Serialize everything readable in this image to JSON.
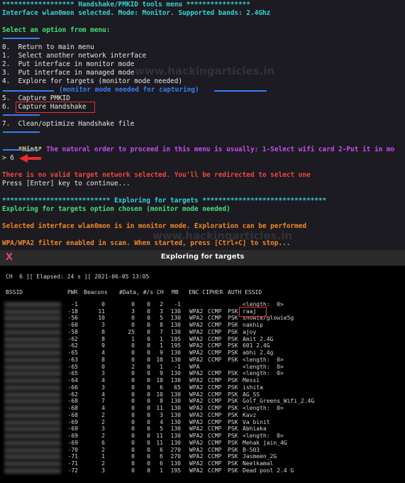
{
  "terminal": {
    "header": "****************** Handshake/PMKID tools menu ****************",
    "interface_line": "Interface wlan0mon selected. Mode: Monitor. Supported bands: 2.4Ghz",
    "select_prompt": "Select an option from menu:",
    "menu_items": [
      "0.  Return to main menu",
      "1.  Select another network interface",
      "2.  Put interface in monitor mode",
      "3.  Put interface in managed mode",
      "4.  Explore for targets (monitor mode needed)"
    ],
    "capture_divider": "(monitor mode needed for capturing)",
    "capture_items": [
      "5.  Capture PMKID",
      "6.  Capture Handshake"
    ],
    "clean_item": "7.  Clean/optimize Handshake file",
    "hint_label": "*Hint*",
    "hint_text": " The natural order to proceed in this menu is usually: 1-Select wifi card 2-Put it in mo",
    "input_prompt": "> 6",
    "error_line": "There is no valid target network selected. You'll be redirected to select one",
    "press_enter": "Press [Enter] key to continue...",
    "explore_header": "*************************** Exploring for targets *******************************",
    "explore_chosen": "Exploring for targets option chosen (monitor mode needed)",
    "selected_iface": "Selected interface wlan0mon is in monitor mode. Exploration can be performed",
    "filter_line": "WPA/WPA2 filter enabled in scan. When started, press [Ctrl+C] to stop...",
    "watermark": "www.hackingarticles.in"
  },
  "window": {
    "title": "Exploring for targets",
    "logo": "X",
    "status": "CH  6 ][ Elapsed: 24 s ][ 2021-06-05 13:05",
    "columns": [
      "BSSID",
      "PWR",
      "Beacons",
      "#Data, #/s",
      "CH",
      "MB",
      "ENC CIPHER",
      "AUTH ESSID"
    ],
    "rows": [
      {
        "pwr": "-1",
        "beacons": "0",
        "data": "0",
        "s": "0",
        "ch": "2",
        "mb": "-1",
        "enc": "",
        "cipher": "",
        "auth": "",
        "essid": "<length:  0>"
      },
      {
        "pwr": "-18",
        "beacons": "11",
        "data": "3",
        "s": "0",
        "ch": "3",
        "mb": "130",
        "enc": "WPA2",
        "cipher": "CCMP",
        "auth": "PSK",
        "essid": "raaj"
      },
      {
        "pwr": "-56",
        "beacons": "10",
        "data": "0",
        "s": "0",
        "ch": "5",
        "mb": "130",
        "enc": "WPA2",
        "cipher": "CCMP",
        "auth": "PSK",
        "essid": "snowie/glowie5g"
      },
      {
        "pwr": "-60",
        "beacons": "3",
        "data": "0",
        "s": "0",
        "ch": "8",
        "mb": "130",
        "enc": "WPA2",
        "cipher": "CCMP",
        "auth": "PSK",
        "essid": "nakhip"
      },
      {
        "pwr": "-58",
        "beacons": "8",
        "data": "25",
        "s": "0",
        "ch": "7",
        "mb": "130",
        "enc": "WPA2",
        "cipher": "CCMP",
        "auth": "PSK",
        "essid": "ajoy"
      },
      {
        "pwr": "-62",
        "beacons": "8",
        "data": "1",
        "s": "0",
        "ch": "1",
        "mb": "195",
        "enc": "WPA2",
        "cipher": "CCMP",
        "auth": "PSK",
        "essid": "Amit 2.4G"
      },
      {
        "pwr": "-62",
        "beacons": "9",
        "data": "0",
        "s": "0",
        "ch": "1",
        "mb": "195",
        "enc": "WPA2",
        "cipher": "CCMP",
        "auth": "PSK",
        "essid": "601 2.4G"
      },
      {
        "pwr": "-65",
        "beacons": "4",
        "data": "0",
        "s": "0",
        "ch": "9",
        "mb": "130",
        "enc": "WPA2",
        "cipher": "CCMP",
        "auth": "PSK",
        "essid": "abhi 2.4g"
      },
      {
        "pwr": "-63",
        "beacons": "8",
        "data": "0",
        "s": "0",
        "ch": "10",
        "mb": "130",
        "enc": "WPA2",
        "cipher": "CCMP",
        "auth": "PSK",
        "essid": "<length:  0>"
      },
      {
        "pwr": "-65",
        "beacons": "0",
        "data": "2",
        "s": "0",
        "ch": "1",
        "mb": "-1",
        "enc": "WPA",
        "cipher": "",
        "auth": "",
        "essid": "<length:  0>"
      },
      {
        "pwr": "-65",
        "beacons": "3",
        "data": "0",
        "s": "0",
        "ch": "9",
        "mb": "130",
        "enc": "WPA2",
        "cipher": "CCMP",
        "auth": "PSK",
        "essid": "<length:  0>"
      },
      {
        "pwr": "-64",
        "beacons": "4",
        "data": "0",
        "s": "0",
        "ch": "10",
        "mb": "130",
        "enc": "WPA2",
        "cipher": "CCMP",
        "auth": "PSK",
        "essid": "Messi"
      },
      {
        "pwr": "-66",
        "beacons": "3",
        "data": "0",
        "s": "0",
        "ch": "6",
        "mb": "65",
        "enc": "WPA2",
        "cipher": "CCMP",
        "auth": "PSK",
        "essid": "ishita"
      },
      {
        "pwr": "-62",
        "beacons": "4",
        "data": "0",
        "s": "0",
        "ch": "10",
        "mb": "130",
        "enc": "WPA2",
        "cipher": "CCMP",
        "auth": "PSK",
        "essid": "AG_SS"
      },
      {
        "pwr": "-68",
        "beacons": "7",
        "data": "0",
        "s": "0",
        "ch": "8",
        "mb": "130",
        "enc": "WPA2",
        "cipher": "CCMP",
        "auth": "PSK",
        "essid": "Golf_Greens_Wifi_2.4G"
      },
      {
        "pwr": "-68",
        "beacons": "4",
        "data": "0",
        "s": "0",
        "ch": "11",
        "mb": "130",
        "enc": "WPA2",
        "cipher": "CCMP",
        "auth": "PSK",
        "essid": "<length:  0>"
      },
      {
        "pwr": "-68",
        "beacons": "2",
        "data": "0",
        "s": "0",
        "ch": "3",
        "mb": "130",
        "enc": "WPA2",
        "cipher": "CCMP",
        "auth": "PSK",
        "essid": "Kavz"
      },
      {
        "pwr": "-69",
        "beacons": "2",
        "data": "0",
        "s": "0",
        "ch": "4",
        "mb": "130",
        "enc": "WPA2",
        "cipher": "CCMP",
        "auth": "PSK",
        "essid": "Va binit"
      },
      {
        "pwr": "-69",
        "beacons": "3",
        "data": "0",
        "s": "0",
        "ch": "5",
        "mb": "130",
        "enc": "WPA2",
        "cipher": "CCMP",
        "auth": "PSK",
        "essid": "Abhiaka"
      },
      {
        "pwr": "-69",
        "beacons": "2",
        "data": "0",
        "s": "0",
        "ch": "11",
        "mb": "130",
        "enc": "WPA2",
        "cipher": "CCMP",
        "auth": "PSK",
        "essid": "<length:  0>"
      },
      {
        "pwr": "-69",
        "beacons": "6",
        "data": "0",
        "s": "0",
        "ch": "11",
        "mb": "130",
        "enc": "WPA2",
        "cipher": "CCMP",
        "auth": "PSK",
        "essid": "Mehak jain_4G"
      },
      {
        "pwr": "-70",
        "beacons": "2",
        "data": "0",
        "s": "0",
        "ch": "6",
        "mb": "270",
        "enc": "WPA2",
        "cipher": "CCMP",
        "auth": "PSK",
        "essid": "B-503"
      },
      {
        "pwr": "-71",
        "beacons": "1",
        "data": "0",
        "s": "0",
        "ch": "6",
        "mb": "270",
        "enc": "WPA2",
        "cipher": "CCMP",
        "auth": "PSK",
        "essid": "Jasmeen_2G"
      },
      {
        "pwr": "-71",
        "beacons": "2",
        "data": "0",
        "s": "0",
        "ch": "6",
        "mb": "130",
        "enc": "WPA2",
        "cipher": "CCMP",
        "auth": "PSK",
        "essid": "Neelkamal"
      },
      {
        "pwr": "-72",
        "beacons": "3",
        "data": "0",
        "s": "0",
        "ch": "1",
        "mb": "195",
        "enc": "WPA2",
        "cipher": "CCMP",
        "auth": "PSK",
        "essid": "Dead pool 2.4 G"
      }
    ]
  },
  "colors": {
    "cyan": "#2fd2d6",
    "green": "#40e07a",
    "red": "#f0473a",
    "orange": "#f08a1a",
    "yellow": "#f0d23a",
    "magenta": "#c14ff0",
    "blue": "#3a7cf0",
    "terminal_bg": "#1c1b22",
    "window_bg": "#000000"
  }
}
